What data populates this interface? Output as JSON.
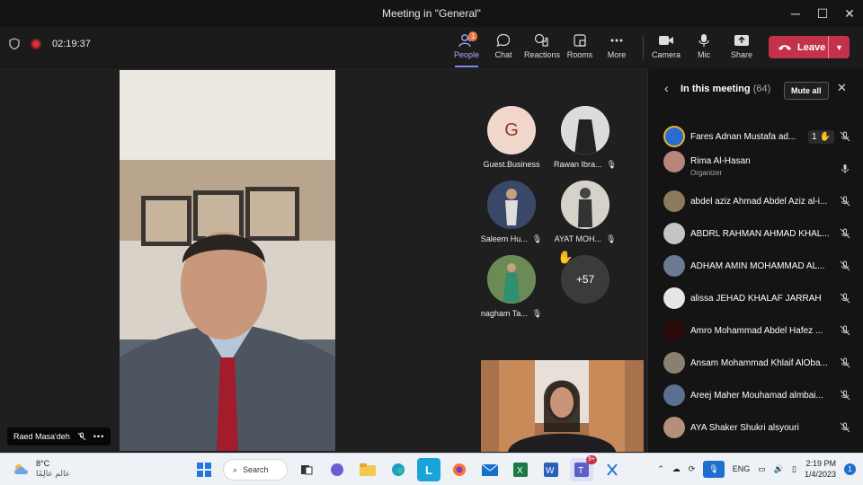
{
  "window": {
    "title": "Meeting in \"General\""
  },
  "meeting": {
    "timer": "02:19:37"
  },
  "toolbar": {
    "people": "People",
    "people_badge": "1",
    "chat": "Chat",
    "reactions": "Reactions",
    "rooms": "Rooms",
    "more": "More",
    "camera": "Camera",
    "mic": "Mic",
    "share": "Share",
    "leave": "Leave"
  },
  "stage": {
    "speaker_name": "Raed Masa'deh"
  },
  "grid": {
    "tiles": [
      {
        "initial": "G",
        "name": "Guest.Business"
      },
      {
        "name": "Rawan Ibra..."
      },
      {
        "name": "Saleem Hu..."
      },
      {
        "name": "AYAT MOH..."
      },
      {
        "name": "nagham Ta..."
      },
      {
        "overflow": "+57"
      }
    ]
  },
  "panel": {
    "title": "In this meeting",
    "count": "(64)",
    "mute_all": "Mute all",
    "participants": [
      {
        "name": "Fares Adnan Mustafa ad...",
        "hand_count": "1",
        "mic": "muted"
      },
      {
        "name": "Rima Al-Hasan",
        "role": "Organizer",
        "mic": "on"
      },
      {
        "name": "abdel aziz Ahmad Abdel Aziz al-i...",
        "mic": "muted"
      },
      {
        "name": "ABDRL RAHMAN AHMAD KHAL...",
        "mic": "muted"
      },
      {
        "name": "ADHAM AMIN MOHAMMAD AL...",
        "mic": "muted"
      },
      {
        "name": "alissa JEHAD KHALAF JARRAH",
        "mic": "muted"
      },
      {
        "name": "Amro Mohammad Abdel Hafez ...",
        "mic": "muted"
      },
      {
        "name": "Ansam Mohammad Khlaif AlOba...",
        "mic": "muted"
      },
      {
        "name": "Areej Maher Mouhamad almbai...",
        "mic": "muted"
      },
      {
        "name": "AYA Shaker Shukri alsyouri",
        "mic": "muted"
      }
    ]
  },
  "taskbar": {
    "weather_temp": "8°C",
    "weather_desc": "عالم عالِمًا",
    "search": "Search",
    "teams_badge": "9+",
    "lang": "ENG",
    "time": "2:19 PM",
    "date": "1/4/2023",
    "notif": "1"
  },
  "colors": {
    "accent": "#7f85f5",
    "leave": "#c4314b",
    "panel_bg": "#141414"
  }
}
